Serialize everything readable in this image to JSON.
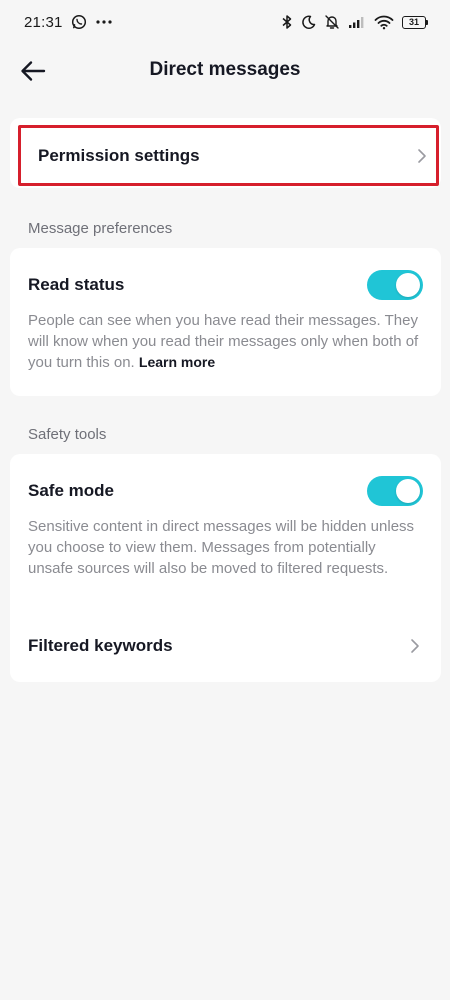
{
  "status_bar": {
    "time": "21:31",
    "battery": "31",
    "icons_left": [
      "whatsapp-icon",
      "more-dots-icon"
    ],
    "icons_right": [
      "bluetooth-icon",
      "moon-icon",
      "mute-icon",
      "signal-icon",
      "wifi-icon",
      "battery-icon"
    ]
  },
  "header": {
    "title": "Direct messages"
  },
  "permission": {
    "label": "Permission settings"
  },
  "sections": {
    "message_preferences": "Message preferences",
    "safety_tools": "Safety tools"
  },
  "read_status": {
    "title": "Read status",
    "enabled": true,
    "description": "People can see when you have read their messages. They will know when you read their messages only when both of you turn this on. ",
    "learn_more": "Learn more"
  },
  "safe_mode": {
    "title": "Safe mode",
    "enabled": true,
    "description": "Sensitive content in direct messages will be hidden unless you choose to view them. Messages from potentially unsafe sources will also be moved to filtered requests."
  },
  "filtered_keywords": {
    "label": "Filtered keywords"
  },
  "colors": {
    "toggle_on": "#20c5d6",
    "highlight": "#d61f2c",
    "background": "#f6f6f6"
  }
}
